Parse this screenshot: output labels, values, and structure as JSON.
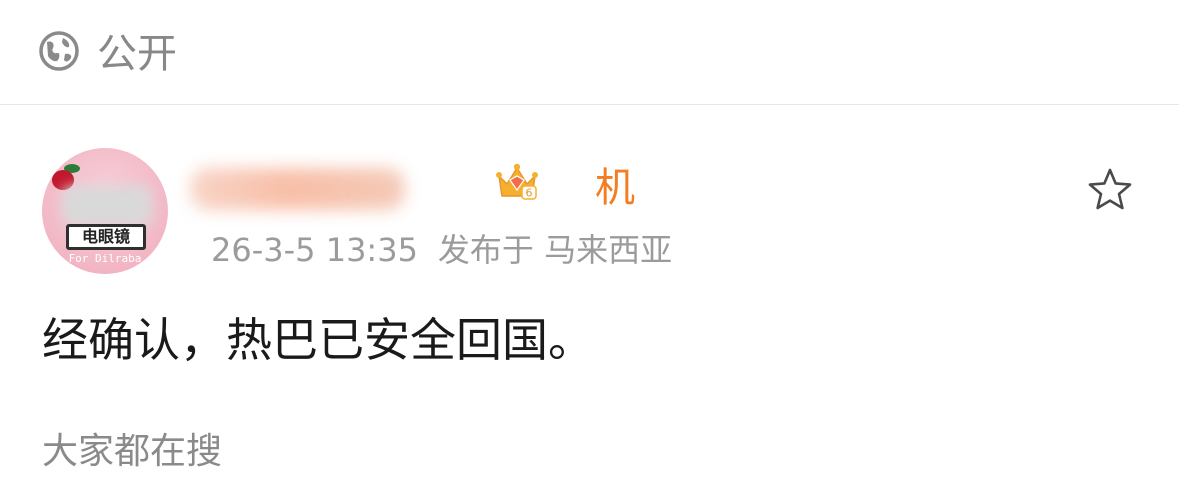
{
  "visibility": {
    "icon": "globe-icon",
    "label": "公开"
  },
  "post": {
    "author": {
      "name_visible_part": "机",
      "name_obscured": true,
      "badge_icon": "crown-icon",
      "badge_level": "6",
      "avatar_sign_text": "电眼镜",
      "avatar_caption": "For Dilraba"
    },
    "timestamp": "26-3-5 13:35",
    "location": "发布于 马来西亚",
    "favorite_icon": "star-icon",
    "text": "经确认，热巴已安全回国。"
  },
  "section": {
    "trending_label": "大家都在搜"
  },
  "colors": {
    "username": "#f27d22",
    "meta_text": "#9b9b9b",
    "body_text": "#1a1a1a",
    "divider": "#e6e6e6",
    "crown_gold": "#f5b12e"
  }
}
